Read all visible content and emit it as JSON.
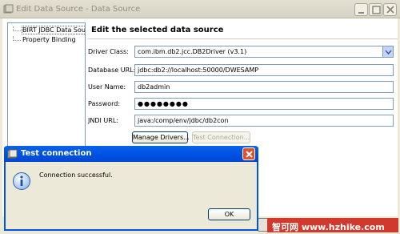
{
  "window": {
    "title": "Edit Data Source - Data Source"
  },
  "nav": {
    "items": [
      {
        "label": "BIRT JDBC Data Source"
      },
      {
        "label": "Property Binding"
      }
    ]
  },
  "form": {
    "heading": "Edit the selected data source",
    "driver_class": {
      "label": "Driver Class:",
      "value": "com.ibm.db2.jcc.DB2Driver (v3.1)"
    },
    "database_url": {
      "label": "Database URL:",
      "value": "jdbc:db2://localhost:50000/DWESAMP"
    },
    "user_name": {
      "label": "User Name:",
      "value": "db2admin"
    },
    "password": {
      "label": "Password:",
      "value": "●●●●●●●●"
    },
    "jndi_url": {
      "label": "JNDI URL:",
      "value": "java:/comp/env/jdbc/db2con"
    },
    "manage_drivers_label": "Manage Drivers...",
    "test_connection_label": "Test Connection..."
  },
  "dialog": {
    "title": "Test connection",
    "message": "Connection successful.",
    "ok_label": "OK"
  },
  "watermark": {
    "text": "智可网 www.hzhike.com"
  },
  "colors": {
    "dialog_title": "#0055e5",
    "close_button": "#e1502c",
    "field_border": "#7f9db9"
  }
}
